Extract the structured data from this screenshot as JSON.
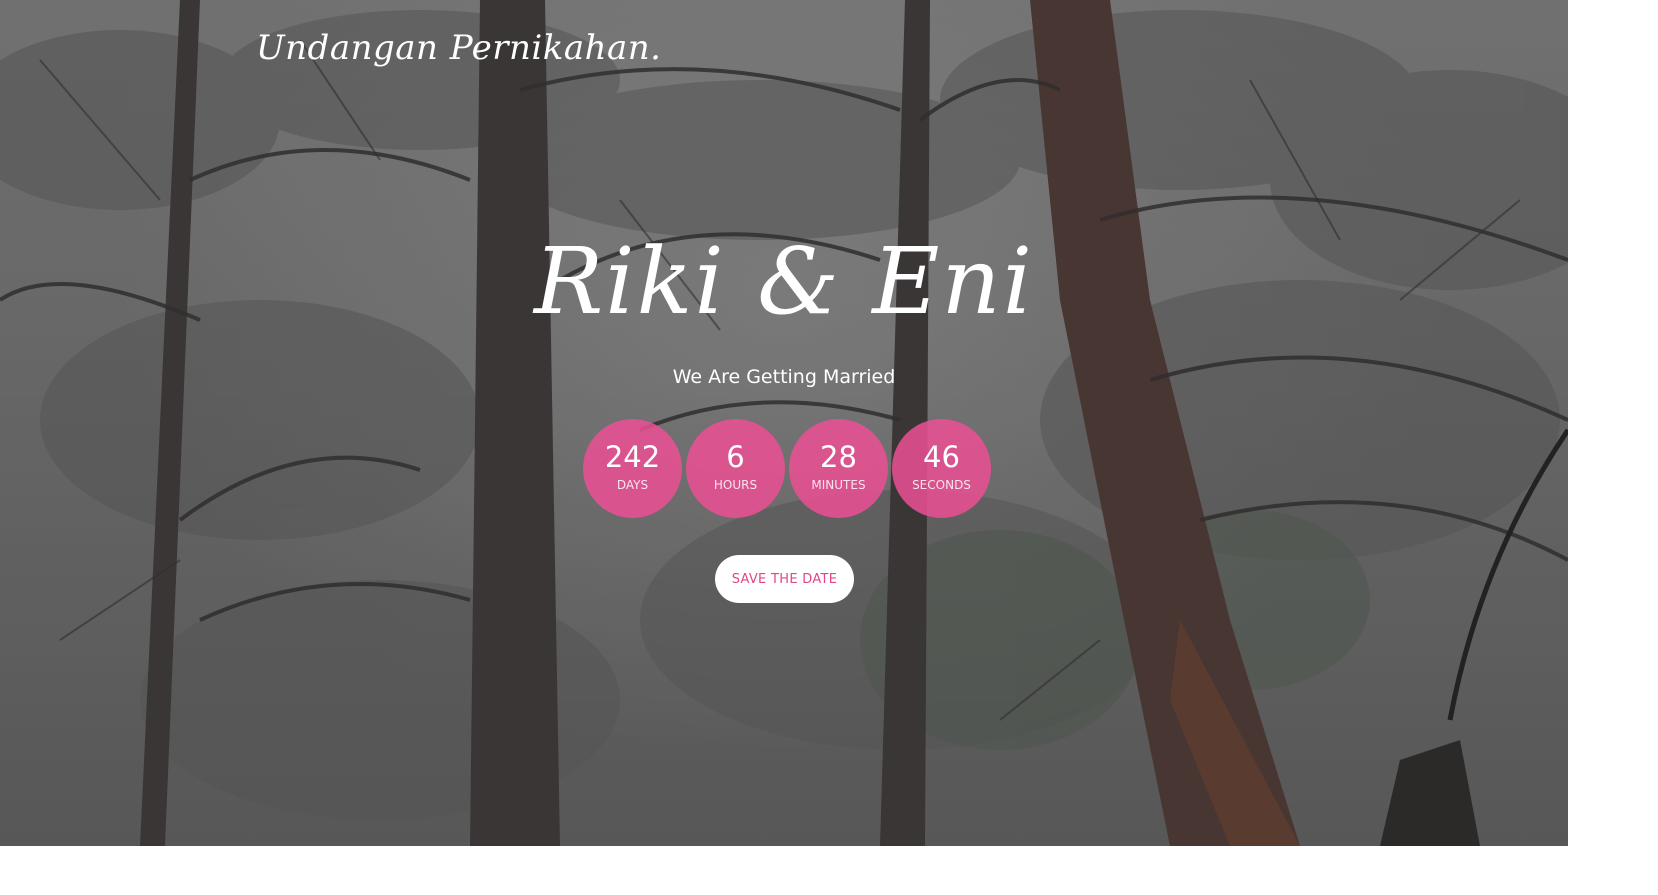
{
  "nav": {
    "brand": "Undangan Pernikahan."
  },
  "hero": {
    "couple_names": "Riki & Eni",
    "tagline": "We Are Getting Married"
  },
  "countdown": {
    "days": {
      "value": "242",
      "label": "DAYS"
    },
    "hours": {
      "value": "6",
      "label": "HOURS"
    },
    "minutes": {
      "value": "28",
      "label": "MINUTES"
    },
    "seconds": {
      "value": "46",
      "label": "SECONDS"
    }
  },
  "cta": {
    "save_label": "SAVE THE DATE"
  },
  "colors": {
    "accent": "#e2458c",
    "countdown_bg": "#ec4f94",
    "text": "#ffffff"
  }
}
